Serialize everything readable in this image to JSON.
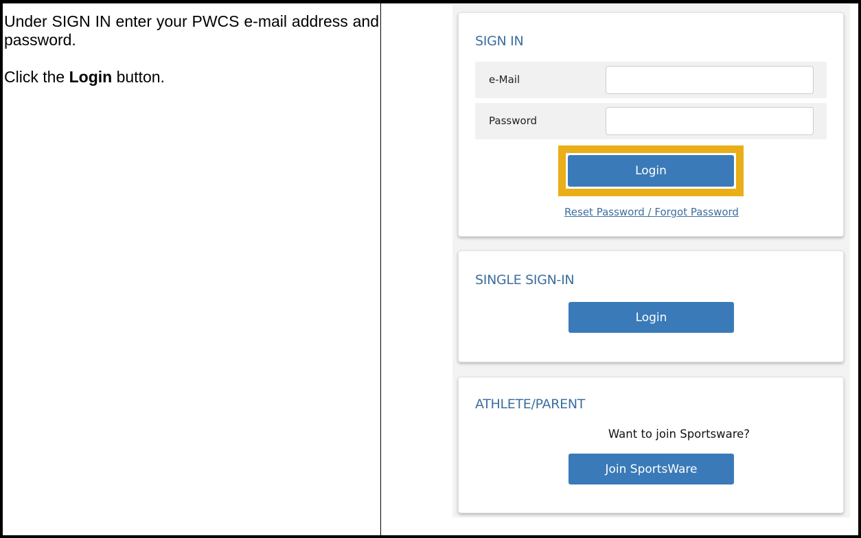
{
  "instructions": {
    "line1": "Under SIGN IN enter your PWCS e-mail address and password.",
    "line2_prefix": "Click the ",
    "line2_bold": "Login",
    "line2_suffix": " button."
  },
  "signin": {
    "title": "SIGN IN",
    "email_label": "e-Mail",
    "email_value": "",
    "password_label": "Password",
    "password_value": "",
    "login_label": "Login",
    "reset_link": "Reset Password / Forgot Password"
  },
  "sso": {
    "title": "SINGLE SIGN-IN",
    "login_label": "Login"
  },
  "athlete": {
    "title": "ATHLETE/PARENT",
    "question": "Want to join Sportsware?",
    "join_label": "Join SportsWare"
  },
  "colors": {
    "accent_blue": "#3a7ab8",
    "title_blue": "#3c6e9e",
    "highlight": "#e9ae18"
  }
}
